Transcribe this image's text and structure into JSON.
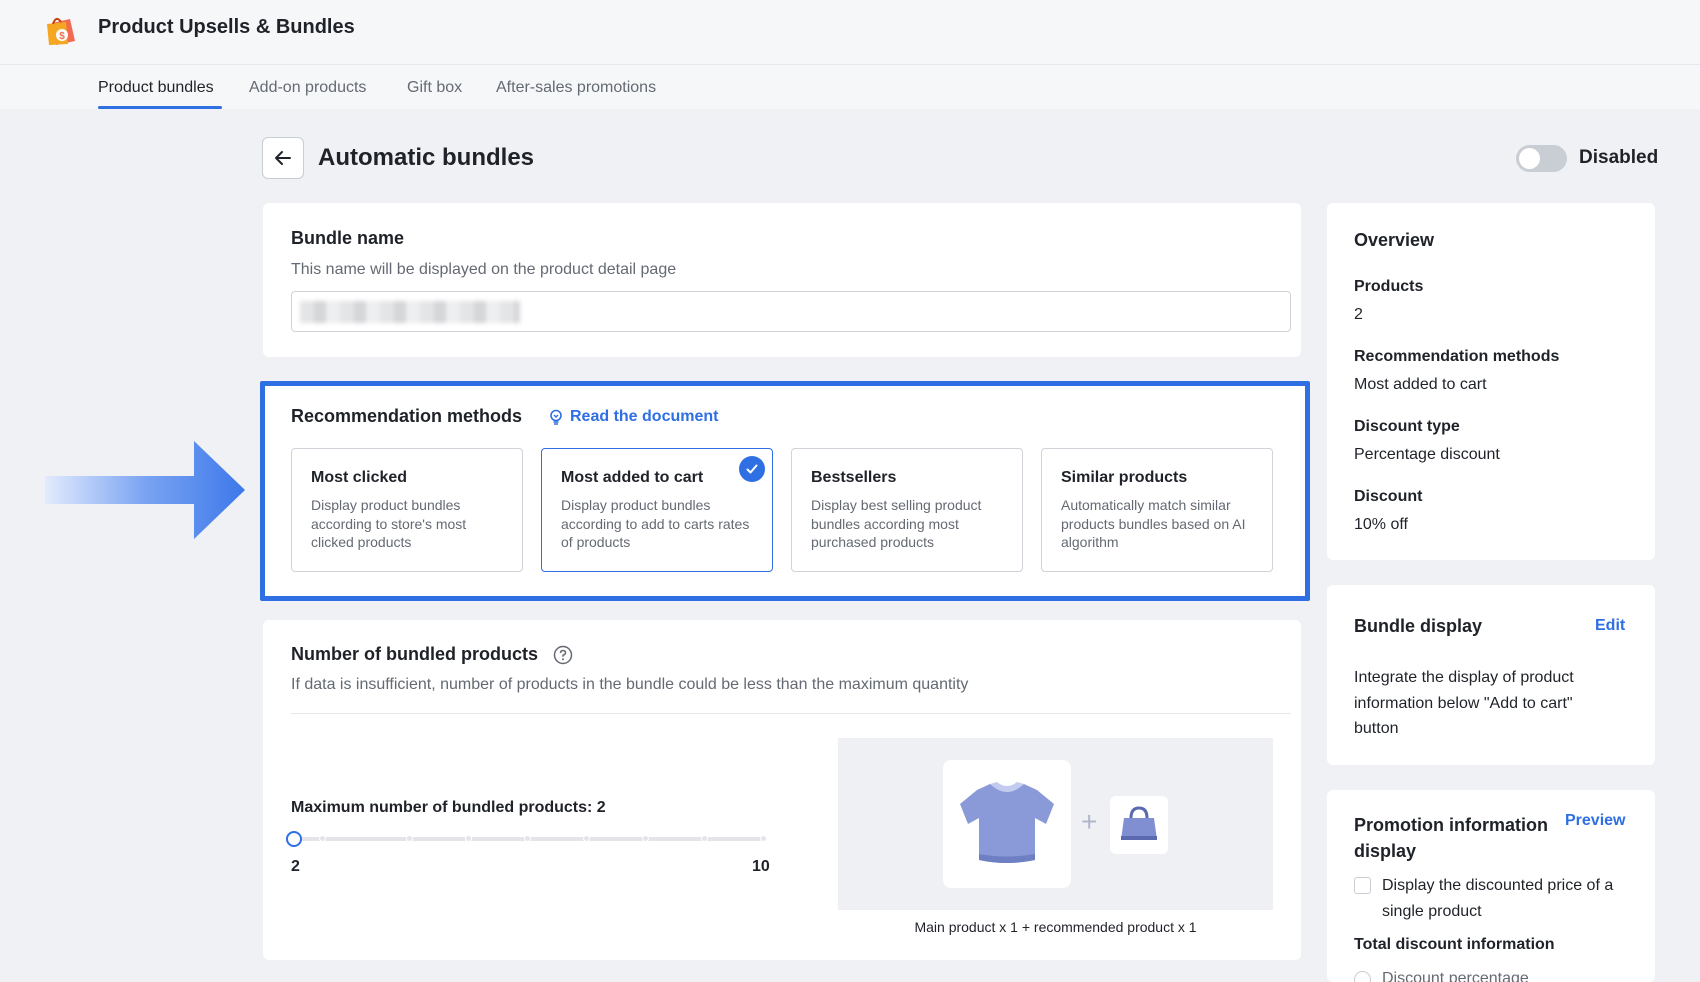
{
  "app": {
    "title": "Product Upsells & Bundles"
  },
  "tabs": [
    {
      "label": "Product bundles",
      "active": true
    },
    {
      "label": "Add-on products",
      "active": false
    },
    {
      "label": "Gift box",
      "active": false
    },
    {
      "label": "After-sales promotions",
      "active": false
    }
  ],
  "page": {
    "title": "Automatic bundles",
    "toggle_label": "Disabled",
    "toggle_enabled": false
  },
  "bundle_name": {
    "title": "Bundle name",
    "subtitle": "This name will be displayed on the product detail page",
    "value": ""
  },
  "recommendation": {
    "title": "Recommendation methods",
    "doc_link": "Read the document",
    "methods": [
      {
        "title": "Most clicked",
        "desc": "Display product bundles according to store's most clicked products",
        "selected": false
      },
      {
        "title": "Most added to cart",
        "desc": "Display product bundles according to add to carts rates of products",
        "selected": true
      },
      {
        "title": "Bestsellers",
        "desc": "Display best selling product bundles according most purchased products",
        "selected": false
      },
      {
        "title": "Similar products",
        "desc": "Automatically match similar products bundles based on AI algorithm",
        "selected": false
      }
    ]
  },
  "bundled_products": {
    "title": "Number of bundled products",
    "subtitle": "If data is insufficient, number of products in the bundle could be less than the maximum quantity",
    "slider_label": "Maximum number of bundled products: 2",
    "slider_min": "2",
    "slider_max": "10",
    "slider_value": 2,
    "preview_caption": "Main product x 1 + recommended product x 1"
  },
  "overview": {
    "title": "Overview",
    "items": [
      {
        "label": "Products",
        "value": "2"
      },
      {
        "label": "Recommendation methods",
        "value": "Most added to cart"
      },
      {
        "label": "Discount type",
        "value": "Percentage discount"
      },
      {
        "label": "Discount",
        "value": "10% off"
      }
    ]
  },
  "bundle_display": {
    "title": "Bundle display",
    "edit_label": "Edit",
    "text": "Integrate the display of product information below \"Add to cart\" button"
  },
  "promotion_display": {
    "title": "Promotion information display",
    "preview_label": "Preview",
    "checkbox_label": "Display the discounted price of a single product",
    "total_label": "Total discount information",
    "radio_label": "Discount percentage"
  },
  "colors": {
    "accent": "#2f6fe4",
    "toggle_off": "#c9cdd4"
  }
}
